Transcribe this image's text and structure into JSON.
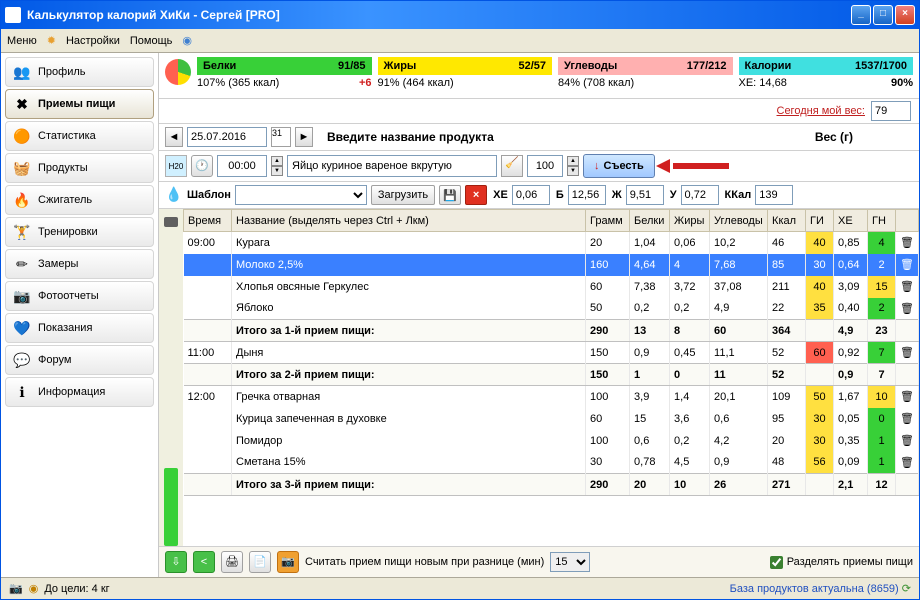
{
  "window": {
    "title": "Калькулятор калорий ХиКи - Сергей [PRO]"
  },
  "menu": {
    "m1": "Меню",
    "m2": "Настройки",
    "m3": "Помощь"
  },
  "sidebar": {
    "items": [
      {
        "label": "Профиль",
        "icon": "👥"
      },
      {
        "label": "Приемы пищи",
        "icon": "✖"
      },
      {
        "label": "Статистика",
        "icon": "🟠"
      },
      {
        "label": "Продукты",
        "icon": "🧺"
      },
      {
        "label": "Сжигатель",
        "icon": "🔥"
      },
      {
        "label": "Тренировки",
        "icon": "🏋"
      },
      {
        "label": "Замеры",
        "icon": "✏"
      },
      {
        "label": "Фотоотчеты",
        "icon": "📷"
      },
      {
        "label": "Показания",
        "icon": "💙"
      },
      {
        "label": "Форум",
        "icon": "💬"
      },
      {
        "label": "Информация",
        "icon": "ℹ"
      }
    ]
  },
  "stats": {
    "protein": {
      "name": "Белки",
      "val": "91/85",
      "sub": "107% (365 ккал)",
      "extra": "+6"
    },
    "fat": {
      "name": "Жиры",
      "val": "52/57",
      "sub": "91% (464 ккал)"
    },
    "carb": {
      "name": "Углеводы",
      "val": "177/212",
      "sub": "84% (708 ккал)"
    },
    "cal": {
      "name": "Калории",
      "val": "1537/1700",
      "sub": "ХЕ: 14,68",
      "pct": "90%"
    }
  },
  "weight": {
    "label": "Сегодня мой вес:",
    "val": "79"
  },
  "date": {
    "val": "25.07.2016",
    "lbl1": "Введите название продукта",
    "lbl2": "Вес (г)"
  },
  "entry": {
    "h20": "H20",
    "time": "00:00",
    "prod": "Яйцо куриное вареное вкрутую",
    "wt": "100",
    "eat": "Съесть"
  },
  "tpl": {
    "lbl": "Шаблон",
    "load": "Загрузить",
    "xe_l": "ХЕ",
    "xe": "0,06",
    "b_l": "Б",
    "b": "12,56",
    "zh_l": "Ж",
    "zh": "9,51",
    "u_l": "У",
    "u": "0,72",
    "k_l": "ККал",
    "k": "139"
  },
  "th": {
    "t": "Время",
    "n": "Название (выделять через Ctrl + Лкм)",
    "g": "Грамм",
    "p": "Белки",
    "f": "Жиры",
    "c": "Углеводы",
    "k": "Ккал",
    "gi": "ГИ",
    "xe": "ХЕ",
    "gn": "ГН"
  },
  "rows": [
    {
      "time": "09:00",
      "name": "Курага",
      "g": "20",
      "p": "1,04",
      "f": "0,06",
      "c": "10,2",
      "k": "46",
      "gi": "40",
      "giC": "gi-y",
      "xe": "0,85",
      "gn": "4",
      "gnC": "gn-g",
      "hl": false
    },
    {
      "time": "",
      "name": "Молоко 2,5%",
      "g": "160",
      "p": "4,64",
      "f": "4",
      "c": "7,68",
      "k": "85",
      "gi": "30",
      "giC": "gi-y",
      "xe": "0,64",
      "gn": "2",
      "gnC": "gn-g",
      "hl": true
    },
    {
      "time": "",
      "name": "Хлопья овсяные Геркулес",
      "g": "60",
      "p": "7,38",
      "f": "3,72",
      "c": "37,08",
      "k": "211",
      "gi": "40",
      "giC": "gi-y",
      "xe": "3,09",
      "gn": "15",
      "gnC": "gn-y",
      "hl": false
    },
    {
      "time": "",
      "name": "Яблоко",
      "g": "50",
      "p": "0,2",
      "f": "0,2",
      "c": "4,9",
      "k": "22",
      "gi": "35",
      "giC": "gi-y",
      "xe": "0,40",
      "gn": "2",
      "gnC": "gn-g",
      "hl": false
    }
  ],
  "tot1": {
    "name": "Итого за 1-й прием пищи:",
    "g": "290",
    "p": "13",
    "f": "8",
    "c": "60",
    "k": "364",
    "xe": "4,9",
    "gn": "23",
    "gnC": "gn-r"
  },
  "rows2": [
    {
      "time": "11:00",
      "name": "Дыня",
      "g": "150",
      "p": "0,9",
      "f": "0,45",
      "c": "11,1",
      "k": "52",
      "gi": "60",
      "giC": "gi-r",
      "xe": "0,92",
      "gn": "7",
      "gnC": "gn-g"
    }
  ],
  "tot2": {
    "name": "Итого за 2-й прием пищи:",
    "g": "150",
    "p": "1",
    "f": "0",
    "c": "11",
    "k": "52",
    "xe": "0,9",
    "gn": "7",
    "gnC": "gn-g"
  },
  "rows3": [
    {
      "time": "12:00",
      "name": "Гречка отварная",
      "g": "100",
      "p": "3,9",
      "f": "1,4",
      "c": "20,1",
      "k": "109",
      "gi": "50",
      "giC": "gi-y",
      "xe": "1,67",
      "gn": "10",
      "gnC": "gn-y"
    },
    {
      "time": "",
      "name": "Курица запеченная в духовке",
      "g": "60",
      "p": "15",
      "f": "3,6",
      "c": "0,6",
      "k": "95",
      "gi": "30",
      "giC": "gi-y",
      "xe": "0,05",
      "gn": "0",
      "gnC": "gn-g"
    },
    {
      "time": "",
      "name": "Помидор",
      "g": "100",
      "p": "0,6",
      "f": "0,2",
      "c": "4,2",
      "k": "20",
      "gi": "30",
      "giC": "gi-y",
      "xe": "0,35",
      "gn": "1",
      "gnC": "gn-g"
    },
    {
      "time": "",
      "name": "Сметана 15%",
      "g": "30",
      "p": "0,78",
      "f": "4,5",
      "c": "0,9",
      "k": "48",
      "gi": "56",
      "giC": "gi-y",
      "xe": "0,09",
      "gn": "1",
      "gnC": "gn-g"
    }
  ],
  "tot3": {
    "name": "Итого за 3-й прием пищи:",
    "g": "290",
    "p": "20",
    "f": "10",
    "c": "26",
    "k": "271",
    "xe": "2,1",
    "gn": "12",
    "gnC": "gn-y"
  },
  "bottom": {
    "txt": "Считать прием пищи новым при разнице (мин)",
    "diff": "15",
    "split": "Разделять приемы пищи"
  },
  "status": {
    "goal": "До цели: 4 кг",
    "db": "База продуктов актуальна (8659)"
  }
}
